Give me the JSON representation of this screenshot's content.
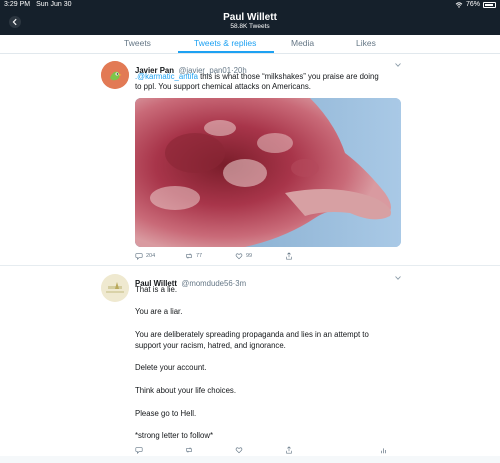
{
  "status_bar": {
    "time": "3:29 PM",
    "date": "Sun Jun 30",
    "battery": "76%"
  },
  "header": {
    "title": "Paul Willett",
    "subtitle": "58.8K Tweets"
  },
  "tabs": [
    {
      "label": "Tweets",
      "active": false
    },
    {
      "label": "Tweets & replies",
      "active": true
    },
    {
      "label": "Media",
      "active": false
    },
    {
      "label": "Likes",
      "active": false
    }
  ],
  "tweet1": {
    "name": "Javier Pan",
    "handle": "@javier_pan01",
    "time": "20h",
    "mention": ".@karmatic_antifa",
    "text_after_mention": " this is what those “milkshakes” you praise are doing",
    "text_line2": "to ppl. You support chemical attacks on Americans.",
    "reply_count": "204",
    "retweet_count": "77",
    "like_count": "99"
  },
  "tweet2": {
    "name": "Paul Willett",
    "handle": "@momdude56",
    "time": "3m",
    "lines": [
      "That is a lie.",
      "You are a liar.",
      "You are deliberately spreading propaganda and lies in an attempt to",
      "support your racism, hatred, and ignorance.",
      "Delete your account.",
      "Think about your life choices.",
      "Please go to Hell.",
      "*strong letter to follow*"
    ]
  },
  "colors": {
    "header_bg": "#15202b",
    "accent": "#1da1f2",
    "muted": "#657786"
  },
  "icons": [
    "back-arrow-icon",
    "wifi-icon",
    "battery-icon",
    "chevron-down-icon",
    "reply-icon",
    "retweet-icon",
    "like-icon",
    "share-icon",
    "analytics-icon"
  ]
}
